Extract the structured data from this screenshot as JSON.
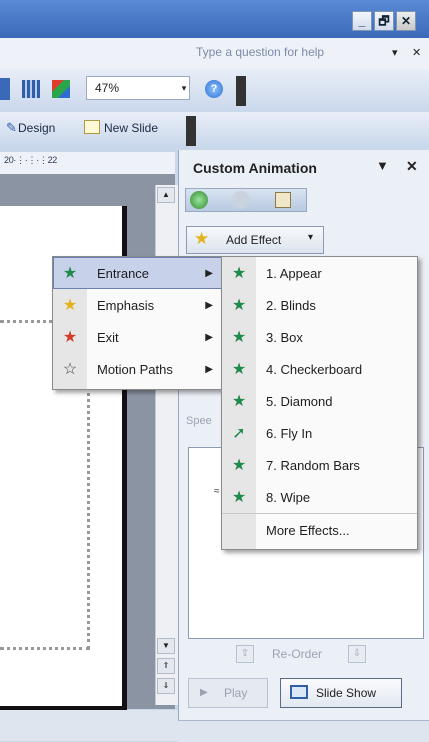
{
  "window": {
    "minimize_glyph": "_",
    "restore_glyph": "🗗",
    "close_glyph": "✕"
  },
  "help": {
    "placeholder": "Type a question for help",
    "dropdown_glyph": "▾",
    "close_glyph": "✕"
  },
  "toolbar": {
    "zoom_value": "47%",
    "zoom_arrow": "▾",
    "help_glyph": "?",
    "design_label": "Design",
    "new_slide_label": "New Slide"
  },
  "ruler": {
    "text": "20·⋮·⋮·⋮22"
  },
  "taskpane": {
    "title": "Custom Animation",
    "menu_glyph": "▼",
    "close_glyph": "✕",
    "add_effect_label": "Add Effect",
    "add_effect_arrow": "▾",
    "speed_label": "Spee",
    "list_marker": "≈",
    "reorder_label": "Re-Order",
    "play_label": "Play",
    "slideshow_label": "Slide Show"
  },
  "menu_primary": {
    "items": [
      {
        "label": "Entrance",
        "icon": "entrance-star-icon",
        "glyph": "★",
        "color": "#1f8a4c",
        "highlighted": true
      },
      {
        "label": "Emphasis",
        "icon": "emphasis-star-icon",
        "glyph": "★",
        "color": "#e3b21c",
        "highlighted": false
      },
      {
        "label": "Exit",
        "icon": "exit-star-icon",
        "glyph": "★",
        "color": "#d33b2a",
        "highlighted": false
      },
      {
        "label": "Motion Paths",
        "icon": "motion-path-star-icon",
        "glyph": "☆",
        "color": "#444444",
        "highlighted": false
      }
    ],
    "arrow_glyph": "▶"
  },
  "menu_entrance": {
    "items": [
      {
        "label": "1. Appear",
        "glyph": "★"
      },
      {
        "label": "2. Blinds",
        "glyph": "★"
      },
      {
        "label": "3. Box",
        "glyph": "★"
      },
      {
        "label": "4. Checkerboard",
        "glyph": "★"
      },
      {
        "label": "5. Diamond",
        "glyph": "★"
      },
      {
        "label": "6. Fly In",
        "glyph": "➚"
      },
      {
        "label": "7. Random Bars",
        "glyph": "★"
      },
      {
        "label": "8. Wipe",
        "glyph": "★"
      }
    ],
    "more_label": "More Effects...",
    "icon_color": "#1f8a4c"
  },
  "colors": {
    "titlebar": "#3a69b8",
    "highlight": "#c7d2ea",
    "slide_bg": "#8b94a3"
  }
}
